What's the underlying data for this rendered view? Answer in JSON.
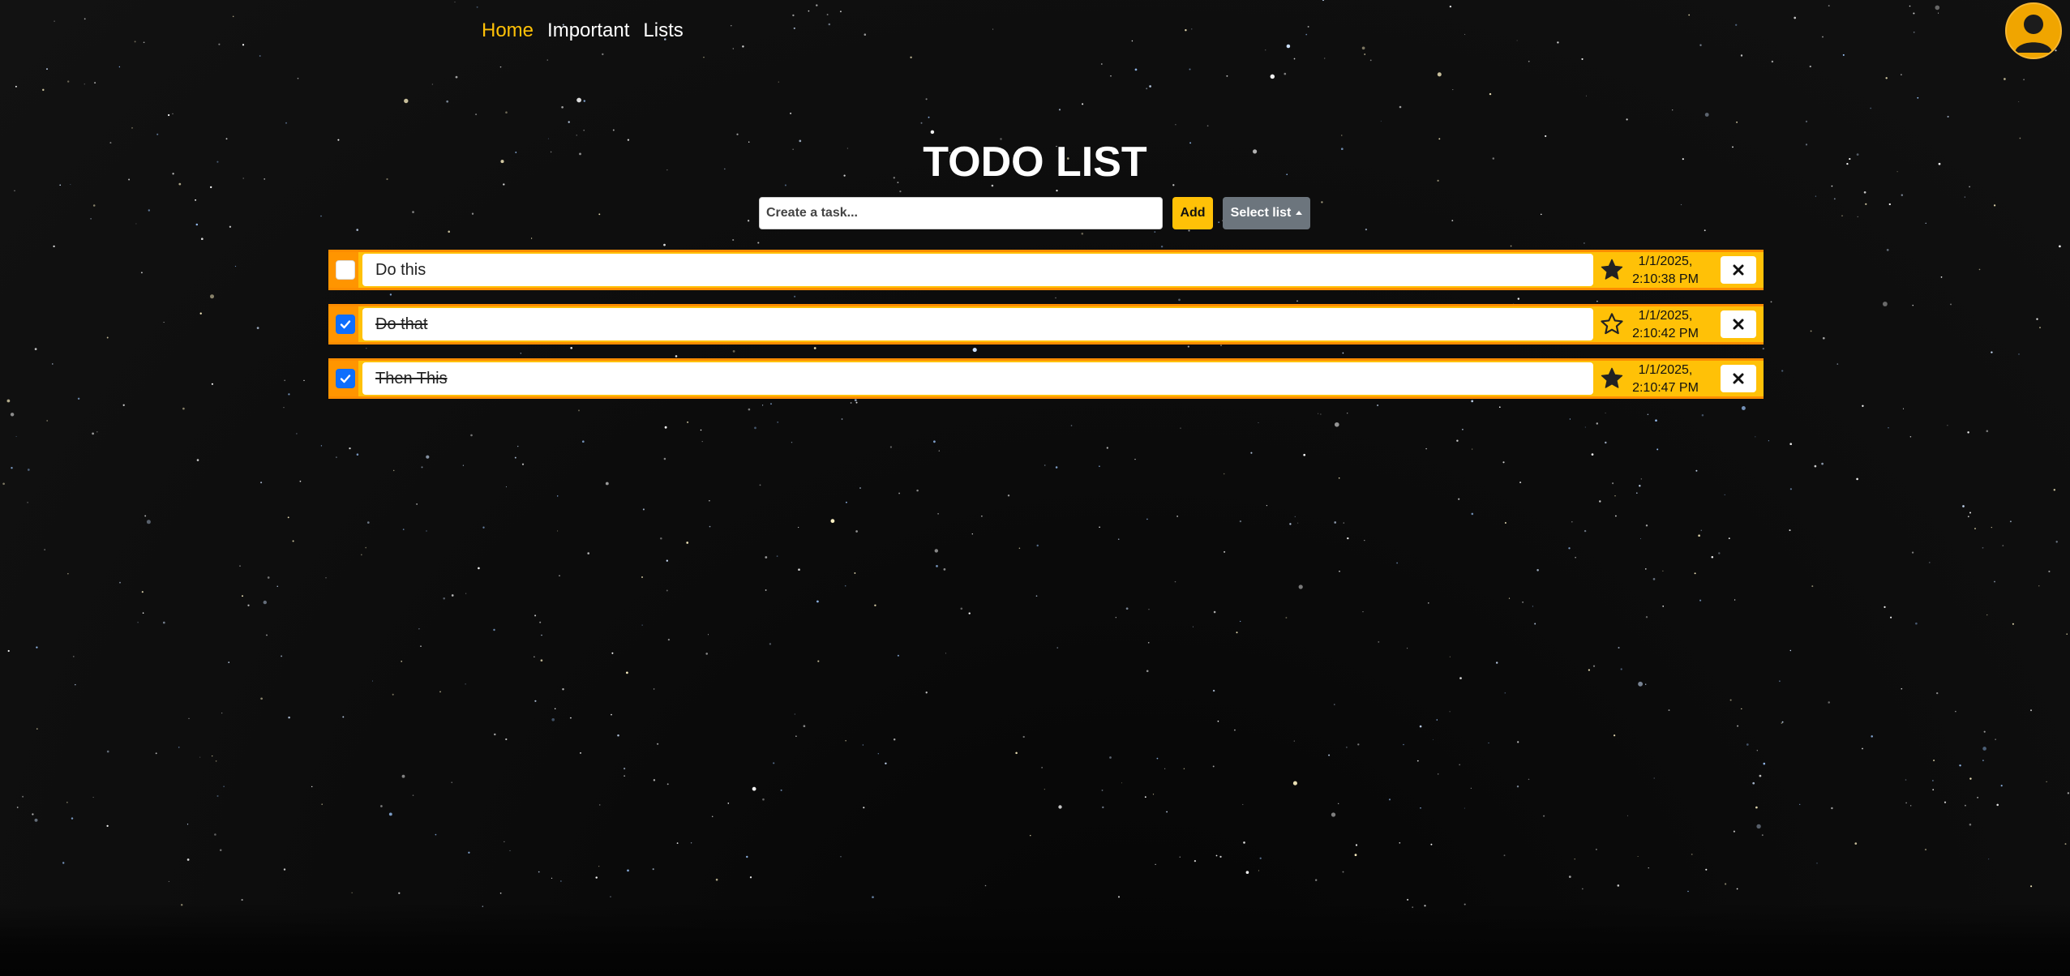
{
  "nav": {
    "items": [
      {
        "label": "Home",
        "active": true
      },
      {
        "label": "Important",
        "active": false
      },
      {
        "label": "Lists",
        "active": false
      }
    ]
  },
  "header": {
    "title": "TODO LIST"
  },
  "add_form": {
    "placeholder": "Create a task...",
    "add_label": "Add",
    "select_label": "Select list"
  },
  "tasks": [
    {
      "text": "Do this",
      "completed": false,
      "important": true,
      "date_line1": "1/1/2025,",
      "date_line2": "2:10:38 PM"
    },
    {
      "text": "Do that",
      "completed": true,
      "important": false,
      "date_line1": "1/1/2025,",
      "date_line2": "2:10:42 PM"
    },
    {
      "text": "Then This",
      "completed": true,
      "important": true,
      "date_line1": "1/1/2025,",
      "date_line2": "2:10:47 PM"
    }
  ],
  "colors": {
    "accent": "#ffc107",
    "active_nav": "#ffc107",
    "task_border": "#fd8c00",
    "checkbox_checked": "#0d6efd",
    "select_button": "#6c757d"
  },
  "icons": {
    "avatar": "user-avatar-icon",
    "important_filled": "star-filled-icon",
    "important_empty": "star-outline-icon",
    "delete": "close-icon",
    "check": "checkmark-icon",
    "dropdown": "caret-up-icon"
  }
}
